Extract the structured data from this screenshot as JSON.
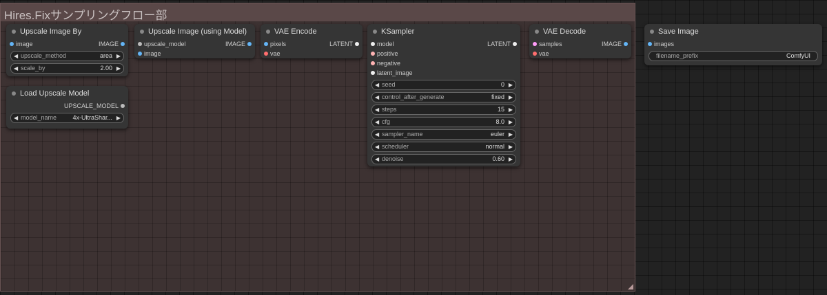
{
  "group": {
    "title": "Hires.Fixサンプリングフロー部"
  },
  "nodes": {
    "upscale_image_by": {
      "title": "Upscale Image By",
      "inputs": [
        "image"
      ],
      "outputs": [
        "IMAGE"
      ],
      "widgets": [
        {
          "label": "upscale_method",
          "value": "area"
        },
        {
          "label": "scale_by",
          "value": "2.00"
        }
      ]
    },
    "load_upscale_model": {
      "title": "Load Upscale Model",
      "outputs": [
        "UPSCALE_MODEL"
      ],
      "widgets": [
        {
          "label": "model_name",
          "value": "4x-UltraShar..."
        }
      ]
    },
    "upscale_image_using_model": {
      "title": "Upscale Image (using Model)",
      "inputs": [
        "upscale_model",
        "image"
      ],
      "outputs": [
        "IMAGE"
      ]
    },
    "vae_encode": {
      "title": "VAE Encode",
      "inputs": [
        "pixels",
        "vae"
      ],
      "outputs": [
        "LATENT"
      ]
    },
    "ksampler": {
      "title": "KSampler",
      "inputs": [
        "model",
        "positive",
        "negative",
        "latent_image"
      ],
      "outputs": [
        "LATENT"
      ],
      "widgets": [
        {
          "label": "seed",
          "value": "0"
        },
        {
          "label": "control_after_generate",
          "value": "fixed"
        },
        {
          "label": "steps",
          "value": "15"
        },
        {
          "label": "cfg",
          "value": "8.0"
        },
        {
          "label": "sampler_name",
          "value": "euler"
        },
        {
          "label": "scheduler",
          "value": "normal"
        },
        {
          "label": "denoise",
          "value": "0.60"
        }
      ]
    },
    "vae_decode": {
      "title": "VAE Decode",
      "inputs": [
        "samples",
        "vae"
      ],
      "outputs": [
        "IMAGE"
      ]
    },
    "save_image": {
      "title": "Save Image",
      "inputs": [
        "images"
      ],
      "widgets": [
        {
          "label": "filename_prefix",
          "value": "ComfyUI"
        }
      ]
    }
  },
  "arrows": {
    "left": "◀",
    "right": "▶"
  }
}
